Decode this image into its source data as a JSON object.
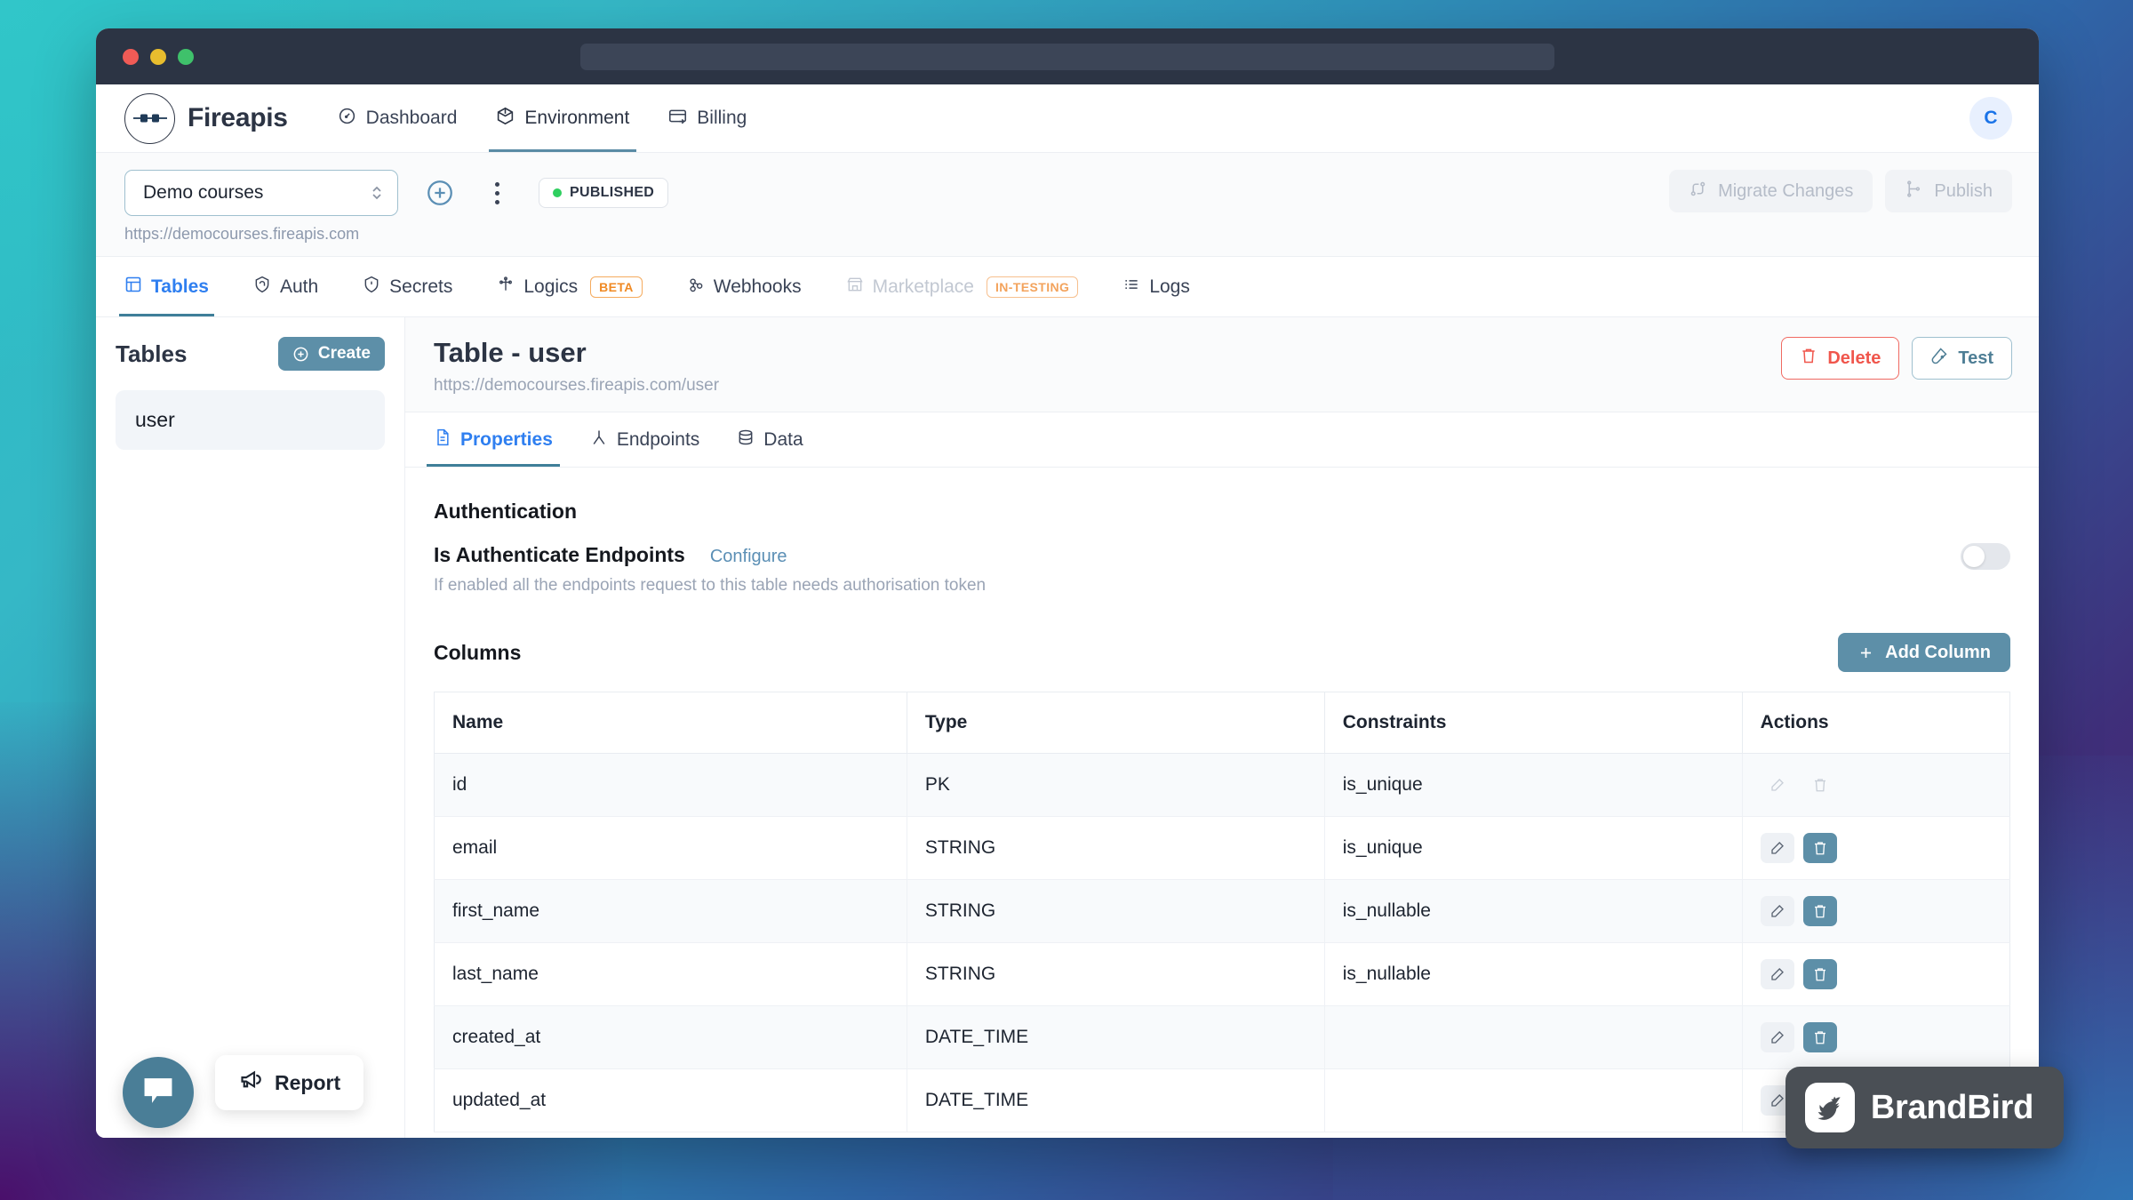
{
  "browser": {
    "traffic_lights": [
      "red",
      "yellow",
      "green"
    ],
    "url_value": ""
  },
  "header": {
    "brand": "Fireapis",
    "logo_icon": "plug-connector-icon",
    "nav": [
      {
        "label": "Dashboard",
        "icon": "gauge-icon",
        "active": false
      },
      {
        "label": "Environment",
        "icon": "cube-icon",
        "active": true
      },
      {
        "label": "Billing",
        "icon": "card-arrow-icon",
        "active": false
      }
    ],
    "avatar_initial": "C"
  },
  "toolbar": {
    "project_selected": "Demo courses",
    "add_icon": "plus-circle-icon",
    "more_icon": "kebab-menu-icon",
    "status_badge": "PUBLISHED",
    "status_color": "#2fcf5f",
    "project_url": "https://democourses.fireapis.com",
    "migrate_label": "Migrate Changes",
    "migrate_icon": "migrate-icon",
    "publish_label": "Publish",
    "publish_icon": "branch-icon"
  },
  "section_tabs": [
    {
      "label": "Tables",
      "icon": "grid-icon",
      "active": true,
      "disabled": false,
      "tag": ""
    },
    {
      "label": "Auth",
      "icon": "fingerprint-shield-icon",
      "active": false,
      "disabled": false,
      "tag": ""
    },
    {
      "label": "Secrets",
      "icon": "shield-icon",
      "active": false,
      "disabled": false,
      "tag": ""
    },
    {
      "label": "Logics",
      "icon": "flow-icon",
      "active": false,
      "disabled": false,
      "tag": "BETA"
    },
    {
      "label": "Webhooks",
      "icon": "webhook-icon",
      "active": false,
      "disabled": false,
      "tag": ""
    },
    {
      "label": "Marketplace",
      "icon": "store-icon",
      "active": false,
      "disabled": true,
      "tag": "IN-TESTING"
    },
    {
      "label": "Logs",
      "icon": "list-icon",
      "active": false,
      "disabled": false,
      "tag": ""
    }
  ],
  "sidebar": {
    "title": "Tables",
    "create_label": "Create",
    "create_icon": "plus-circle-icon",
    "items": [
      {
        "label": "user",
        "selected": true
      }
    ]
  },
  "main": {
    "title": "Table - user",
    "url": "https://democourses.fireapis.com/user",
    "delete_label": "Delete",
    "delete_icon": "trash-icon",
    "test_label": "Test",
    "test_icon": "test-tube-icon",
    "subtabs": [
      {
        "label": "Properties",
        "icon": "document-icon",
        "active": true
      },
      {
        "label": "Endpoints",
        "icon": "endpoint-icon",
        "active": false
      },
      {
        "label": "Data",
        "icon": "database-icon",
        "active": false
      }
    ],
    "authentication": {
      "section_title": "Authentication",
      "label": "Is Authenticate Endpoints",
      "configure_label": "Configure",
      "description": "If enabled all the endpoints request to this table needs authorisation token",
      "toggle_on": false
    },
    "columns": {
      "section_title": "Columns",
      "add_label": "Add Column",
      "add_icon": "plus-icon",
      "headers": [
        "Name",
        "Type",
        "Constraints",
        "Actions"
      ],
      "rows": [
        {
          "name": "id",
          "type": "PK",
          "constraints": "is_unique",
          "actions_enabled": false
        },
        {
          "name": "email",
          "type": "STRING",
          "constraints": "is_unique",
          "actions_enabled": true
        },
        {
          "name": "first_name",
          "type": "STRING",
          "constraints": "is_nullable",
          "actions_enabled": true
        },
        {
          "name": "last_name",
          "type": "STRING",
          "constraints": "is_nullable",
          "actions_enabled": true
        },
        {
          "name": "created_at",
          "type": "DATE_TIME",
          "constraints": "",
          "actions_enabled": true
        },
        {
          "name": "updated_at",
          "type": "DATE_TIME",
          "constraints": "",
          "actions_enabled": true
        }
      ],
      "edit_icon": "pencil-icon",
      "delete_icon": "trash-icon"
    }
  },
  "floating": {
    "chat_icon": "chat-bubble-icon",
    "report_label": "Report",
    "report_icon": "megaphone-icon",
    "watermark": "BrandBird",
    "watermark_icon": "brandbird-logo-icon"
  },
  "colors": {
    "accent_blue": "#2f7ff0",
    "steel": "#5d8fa8",
    "danger": "#f0564c",
    "published_green": "#2fcf5f",
    "beta_orange": "#f08a24"
  }
}
